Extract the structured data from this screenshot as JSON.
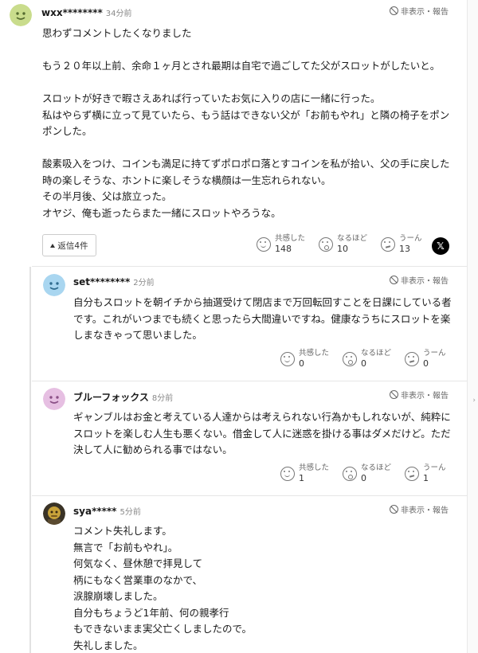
{
  "colors": {
    "text": "#1a1a1a",
    "muted": "#888888",
    "border": "#cccccc",
    "thread_line": "#e2e2e2"
  },
  "actions": {
    "hide_report": "非表示・報告"
  },
  "reaction_labels": {
    "empathy": "共感した",
    "insight": "なるほど",
    "hmm": "うーん"
  },
  "comments": [
    {
      "author": "wxx********",
      "time": "34分前",
      "avatar": "smiley-yellow-green",
      "text": "思わずコメントしたくなりました\n\nもう２０年以上前、余命１ヶ月とされ最期は自宅で過ごしてた父がスロットがしたいと。\n\nスロットが好きで暇さえあれば行っていたお気に入りの店に一緒に行った。\n私はやらず横に立って見ていたら、もう話はできない父が「お前もやれ」と隣の椅子をポンポンした。\n\n酸素吸入をつけ、コインも満足に持てずポロポロ落とすコインを私が拾い、父の手に戻した時の楽しそうな、ホントに楽しそうな横顔は一生忘れられない。\nその半月後、父は旅立った。\nオヤジ、俺も逝ったらまた一緒にスロットやろうな。",
      "reply_button": "返信4件",
      "share_icon": "x-logo",
      "reactions": {
        "empathy": "148",
        "insight": "10",
        "hmm": "13"
      }
    },
    {
      "author": "set********",
      "time": "2分前",
      "avatar": "smiley-light-blue",
      "text": "自分もスロットを朝イチから抽選受けて閉店まで万回転回すことを日課にしている者です。これがいつまでも続くと思ったら大間違いですね。健康なうちにスロットを楽しまなきゃって思いました。",
      "reactions": {
        "empathy": "0",
        "insight": "0",
        "hmm": "0"
      }
    },
    {
      "author": "ブルーフォックス",
      "time": "8分前",
      "avatar": "smiley-pink",
      "text": "ギャンブルはお金と考えている人達からは考えられない行為かもしれないが、純粋にスロットを楽しむ人生も悪くない。借金して人に迷惑を掛ける事はダメだけど。ただ決して人に勧められる事ではない。",
      "reactions": {
        "empathy": "1",
        "insight": "0",
        "hmm": "1"
      }
    },
    {
      "author": "sya*****",
      "time": "5分前",
      "avatar": "photo-avatar",
      "text": "コメント失礼します。\n無言で「お前もやれ」。\n何気なく、昼休憩で拝見して\n柄にもなく営業車のなかで、\n涙腺崩壊しました。\n自分もちょうど1年前、何の親孝行\nもできないまま実父亡くしましたので。\n失礼しました。"
    }
  ]
}
